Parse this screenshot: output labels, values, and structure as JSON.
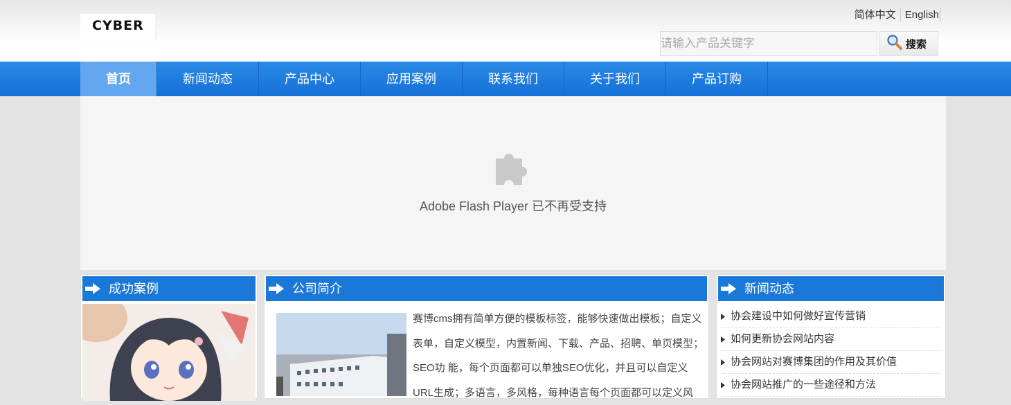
{
  "header": {
    "logo_text": "CYBER",
    "languages": [
      "简体中文",
      "English"
    ],
    "search": {
      "placeholder": "请输入产品关键字",
      "button_label": "搜索"
    }
  },
  "nav": {
    "items": [
      "首页",
      "新闻动态",
      "产品中心",
      "应用案例",
      "联系我们",
      "关于我们",
      "产品订购"
    ],
    "active_index": 0
  },
  "banner": {
    "message": "Adobe Flash Player 已不再受支持"
  },
  "cases": {
    "title": "成功案例"
  },
  "about": {
    "title": "公司简介",
    "text": "赛博cms拥有简单方便的模板标签，能够快速做出模板；自定义表单，自定义模型，内置新闻、下载、产品、招聘、单页模型；SEO功 能，每个页面都可以单独SEO优化，并且可以自定义URL生成；多语言，多风格，每种语言每个页面都可以定义风"
  },
  "news": {
    "title": "新闻动态",
    "items": [
      "协会建设中如何做好宣传营销",
      "如何更新协会网站内容",
      "协会网站对赛博集团的作用及其价值",
      "协会网站推广的一些途径和方法"
    ]
  },
  "colors": {
    "nav_blue": "#1f7de0",
    "panel_head": "#1a78d8",
    "active_nav": "#62a7ef"
  }
}
